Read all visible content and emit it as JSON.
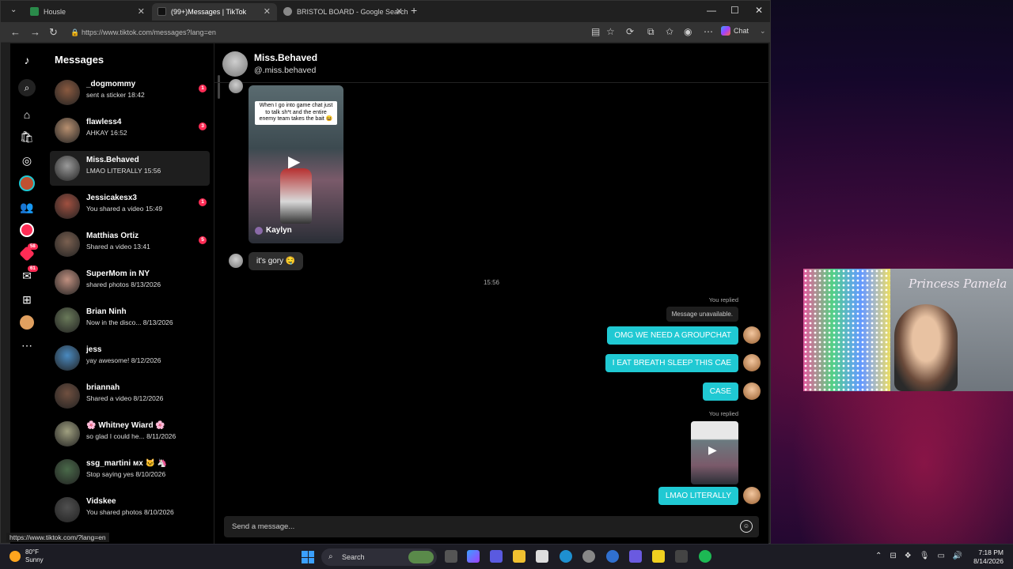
{
  "browser": {
    "tabs": [
      {
        "label": "Housle",
        "active": false
      },
      {
        "label": "(99+)Messages | TikTok",
        "active": true
      },
      {
        "label": "BRISTOL BOARD - Google Search",
        "active": false
      }
    ],
    "url": "https://www.tiktok.com/messages?lang=en",
    "chat_label": "Chat",
    "status_url": "https://www.tiktok.com/?lang=en"
  },
  "rail": {
    "badges": {
      "activity": "58",
      "inbox": "61"
    }
  },
  "messages": {
    "title": "Messages",
    "conversations": [
      {
        "name": "_dogmommy",
        "preview": "sent a sticker  18:42",
        "unread": "1",
        "color": "#8a5a40"
      },
      {
        "name": "flawless4",
        "preview": "AHKAY  16:52",
        "unread": "3",
        "color": "#b89070"
      },
      {
        "name": "Miss.Behaved",
        "preview": "LMAO LITERALLY  15:56",
        "unread": "",
        "color": "#9a9a9a"
      },
      {
        "name": "Jessicakesx3",
        "preview": "You shared a video  15:49",
        "unread": "1",
        "color": "#a05040"
      },
      {
        "name": "Matthias Ortiz",
        "preview": "Shared a video  13:41",
        "unread": "5",
        "color": "#7a6050"
      },
      {
        "name": "SuperMom in NY",
        "preview": "shared photos  8/13/2026",
        "unread": "",
        "color": "#c09080"
      },
      {
        "name": "Brian Ninh",
        "preview": "Now in the disco...  8/13/2026",
        "unread": "",
        "color": "#6a7a5a"
      },
      {
        "name": "jess",
        "preview": "yay awesome!  8/12/2026",
        "unread": "",
        "color": "#4a8ac0"
      },
      {
        "name": "briannah",
        "preview": "Shared a video  8/12/2026",
        "unread": "",
        "color": "#705040"
      },
      {
        "name": "🌸 Whitney Wiard 🌸",
        "preview": "so glad I could he...  8/11/2026",
        "unread": "",
        "color": "#a0a080"
      },
      {
        "name": "ssg_martini ᴍx 🐱 🦄",
        "preview": "Stop saying yes  8/10/2026",
        "unread": "",
        "color": "#4a6a4a"
      },
      {
        "name": "Vidskee",
        "preview": "You shared photos  8/10/2026",
        "unread": "",
        "color": "#505050"
      }
    ]
  },
  "chat": {
    "name": "Miss.Behaved",
    "handle": "@.miss.behaved",
    "video_caption": "When I go into game chat just to talk sh*t and the entire enemy team takes the bait 😆",
    "video_author": "Kaylyn",
    "their_message": "it's gory 🤤",
    "timestamp": "15:56",
    "you_replied": "You replied",
    "message_unavailable": "Message unavailable.",
    "my_messages": [
      "OMG WE NEED A GROUPCHAT",
      "I EAT BREATH SLEEP THIS CAE",
      "CASE"
    ],
    "last_message": "LMAO LITERALLY",
    "input_placeholder": "Send a message..."
  },
  "webcam": {
    "title": "Princess Pamela"
  },
  "taskbar": {
    "weather_temp": "80°F",
    "weather_desc": "Sunny",
    "search_label": "Search",
    "time": "7:18 PM",
    "date": "8/14/2026"
  }
}
